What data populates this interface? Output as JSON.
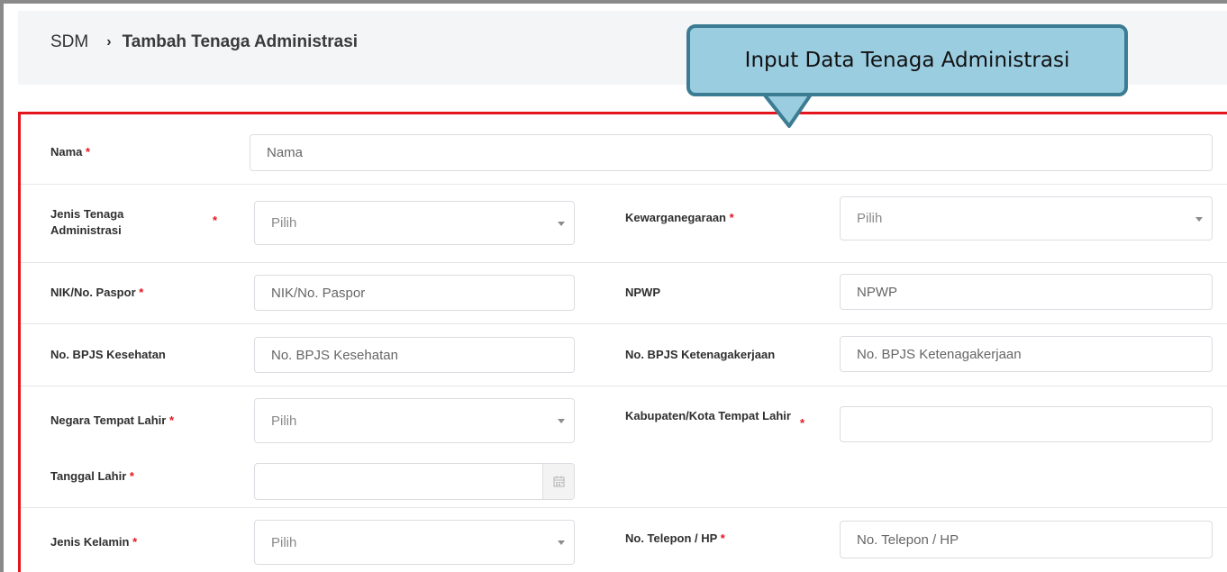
{
  "breadcrumb": {
    "root": "SDM",
    "separator": "›",
    "current": "Tambah Tenaga Administrasi"
  },
  "callout": {
    "text": "Input Data Tenaga Administrasi"
  },
  "form": {
    "nama": {
      "label": "Nama",
      "required": "*",
      "placeholder": "Nama"
    },
    "jenis_tenaga": {
      "label": "Jenis Tenaga Administrasi",
      "required": "*",
      "value": "Pilih"
    },
    "kewarganegaraan": {
      "label": "Kewarganegaraan",
      "required": "*",
      "value": "Pilih"
    },
    "nik": {
      "label": "NIK/No. Paspor",
      "required": "*",
      "placeholder": "NIK/No. Paspor"
    },
    "npwp": {
      "label": "NPWP",
      "placeholder": "NPWP"
    },
    "bpjs_kesehatan": {
      "label": "No. BPJS Kesehatan",
      "placeholder": "No. BPJS Kesehatan"
    },
    "bpjs_ketenagakerjaan": {
      "label": "No. BPJS Ketenagakerjaan",
      "placeholder": "No. BPJS Ketenagakerjaan"
    },
    "negara_lahir": {
      "label": "Negara Tempat Lahir",
      "required": "*",
      "value": "Pilih"
    },
    "kota_lahir": {
      "label": "Kabupaten/Kota Tempat Lahir",
      "required": "*",
      "value": ""
    },
    "tanggal_lahir": {
      "label": "Tanggal Lahir",
      "required": "*",
      "value": ""
    },
    "jenis_kelamin": {
      "label": "Jenis Kelamin",
      "required": "*",
      "value": "Pilih"
    },
    "telepon": {
      "label": "No. Telepon / HP",
      "required": "*",
      "placeholder": "No. Telepon / HP"
    }
  },
  "icons": {
    "breadcrumb_separator": "chevron-right-icon",
    "select_caret": "caret-down-icon",
    "date_picker": "calendar-icon"
  },
  "colors": {
    "highlight_border": "#e3161d",
    "required_mark": "#e3161d",
    "callout_fill": "#9bcde0",
    "callout_border": "#3c7c92",
    "header_bg": "#f4f5f7"
  }
}
